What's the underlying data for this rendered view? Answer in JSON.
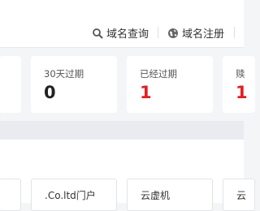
{
  "header": {
    "nav": [
      {
        "icon": "search-icon",
        "label": "域名查询"
      },
      {
        "icon": "globe-icon",
        "label": "域名注册"
      }
    ]
  },
  "stats": [
    {
      "label": "30天过期",
      "value": "0",
      "color": "#222222"
    },
    {
      "label": "已经过期",
      "value": "1",
      "color": "#e02020"
    },
    {
      "label": "赎",
      "value": "1",
      "color": "#e02020"
    }
  ],
  "products": [
    {
      "label": ".Co.ltd门户"
    },
    {
      "label": "云虚机"
    },
    {
      "label": "云"
    }
  ]
}
